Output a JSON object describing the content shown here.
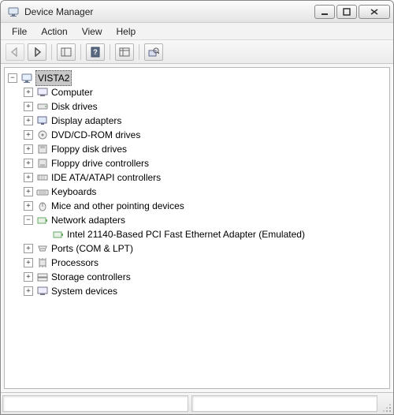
{
  "window": {
    "title": "Device Manager"
  },
  "menu": {
    "file": "File",
    "action": "Action",
    "view": "View",
    "help": "Help"
  },
  "tree": {
    "root": "VISTA2",
    "items": [
      {
        "label": "Computer"
      },
      {
        "label": "Disk drives"
      },
      {
        "label": "Display adapters"
      },
      {
        "label": "DVD/CD-ROM drives"
      },
      {
        "label": "Floppy disk drives"
      },
      {
        "label": "Floppy drive controllers"
      },
      {
        "label": "IDE ATA/ATAPI controllers"
      },
      {
        "label": "Keyboards"
      },
      {
        "label": "Mice and other pointing devices"
      },
      {
        "label": "Network adapters"
      },
      {
        "label": "Ports (COM & LPT)"
      },
      {
        "label": "Processors"
      },
      {
        "label": "Storage controllers"
      },
      {
        "label": "System devices"
      }
    ],
    "network_child": "Intel 21140-Based PCI Fast Ethernet Adapter (Emulated)"
  }
}
